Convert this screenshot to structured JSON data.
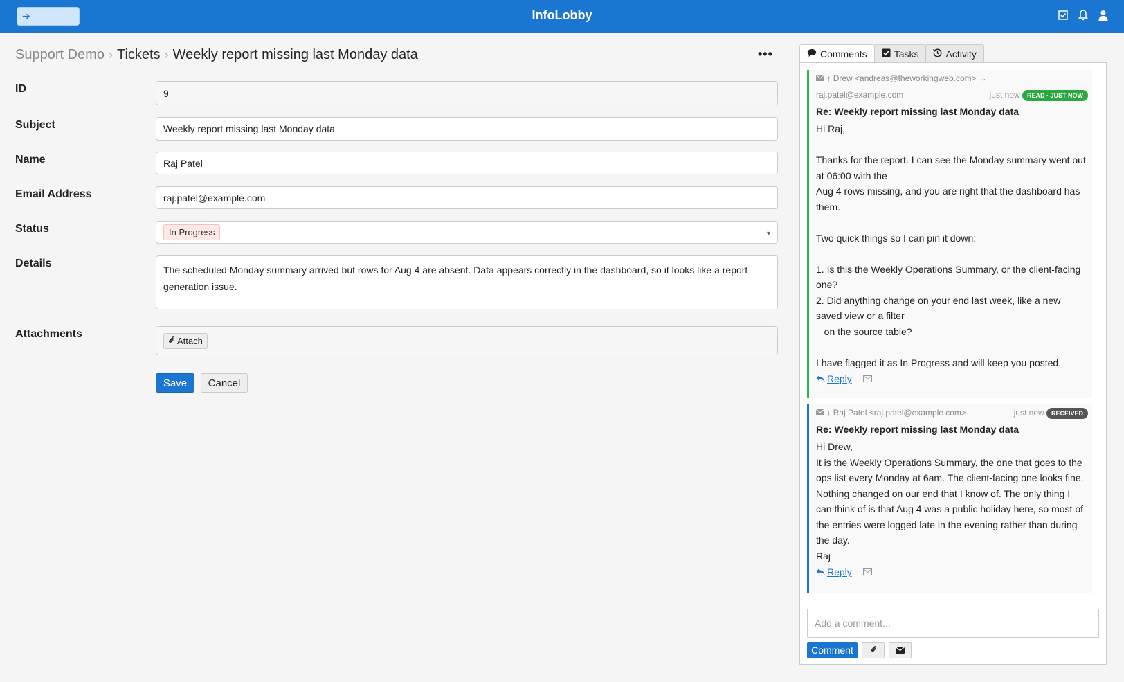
{
  "app": {
    "title": "InfoLobby"
  },
  "breadcrumb": {
    "workspace": "Support Demo",
    "app": "Tickets",
    "item": "Weekly report missing last Monday data"
  },
  "form": {
    "id_label": "ID",
    "id_value": "9",
    "subject_label": "Subject",
    "subject_value": "Weekly report missing last Monday data",
    "name_label": "Name",
    "name_value": "Raj Patel",
    "email_label": "Email Address",
    "email_value": "raj.patel@example.com",
    "status_label": "Status",
    "status_value": "In Progress",
    "details_label": "Details",
    "details_value": "The scheduled Monday summary arrived but rows for Aug 4 are absent. Data appears correctly in the dashboard, so it looks like a report generation issue.",
    "attachments_label": "Attachments",
    "attach_label": "Attach",
    "save_label": "Save",
    "cancel_label": "Cancel"
  },
  "tabs": [
    {
      "label": "Comments",
      "icon": "comment-icon"
    },
    {
      "label": "Tasks",
      "icon": "check-square-icon"
    },
    {
      "label": "Activity",
      "icon": "history-icon"
    }
  ],
  "comments": [
    {
      "from": "Drew <andreas@theworkingweb.com> →",
      "to": "raj.patel@example.com",
      "time": "just now",
      "badge": "READ · JUST NOW",
      "badge_color": "#2ba840",
      "subject": "Re: Weekly report missing last Monday data",
      "body": "Hi Raj,\n\nThanks for the report. I can see the Monday summary went out at 06:00 with the\nAug 4 rows missing, and you are right that the dashboard has them.\n\nTwo quick things so I can pin it down:\n\n1. Is this the Weekly Operations Summary, or the client-facing one?\n2. Did anything change on your end last week, like a new saved view or a filter\n   on the source table?\n\nI have flagged it as In Progress and will keep you posted.",
      "reply_label": "Reply"
    },
    {
      "from": "Raj Patel <raj.patel@example.com>",
      "time": "just now",
      "badge": "RECEIVED",
      "badge_color": "#555555",
      "subject": "Re: Weekly report missing last Monday data",
      "body": "Hi Drew,\nIt is the Weekly Operations Summary, the one that goes to the ops list every Monday at 6am. The client-facing one looks fine. Nothing changed on our end that I know of. The only thing I can think of is that Aug 4 was a public holiday here, so most of the entries were logged late in the evening rather than during the day.\nRaj",
      "reply_label": "Reply"
    }
  ],
  "composer": {
    "placeholder": "Add a comment...",
    "comment_label": "Comment"
  }
}
